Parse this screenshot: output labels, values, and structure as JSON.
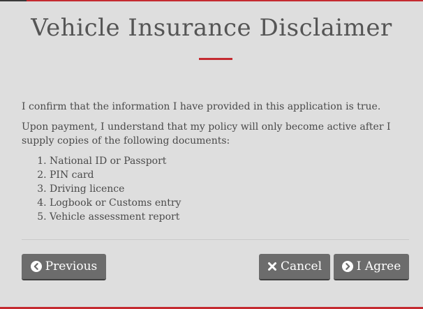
{
  "dialog": {
    "title": "Vehicle Insurance Disclaimer"
  },
  "content": {
    "confirm_text": "I confirm that the information I have provided in this application is true.",
    "payment_text": "Upon payment, I understand that my policy will only become active after I supply copies of the following documents:",
    "documents": [
      "National ID or Passport",
      "PIN card",
      "Driving licence",
      "Logbook or Customs entry",
      "Vehicle assessment report"
    ]
  },
  "buttons": {
    "previous_label": "Previous",
    "cancel_label": "Cancel",
    "agree_label": "I Agree",
    "previous_icon": "chevron-circle-left-icon",
    "cancel_icon": "close-icon",
    "agree_icon": "chevron-circle-right-icon"
  },
  "colors": {
    "accent": "#c42a30",
    "background": "#dedede",
    "button": "#6c6c6c"
  }
}
